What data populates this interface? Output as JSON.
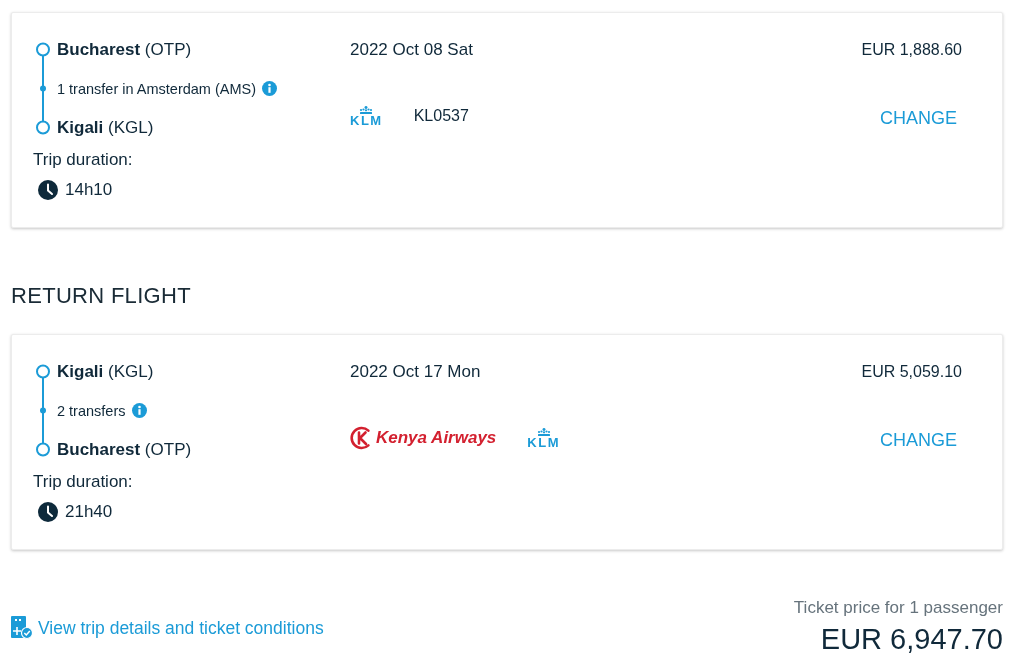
{
  "flights": [
    {
      "origin": "**Bucharest** (OTP)",
      "stops": "1 transfer in Amsterdam (AMS)",
      "destination": "**Kigali** (KGL)",
      "duration_label": "Trip duration:",
      "duration": "14h10",
      "date": "2022 Oct 08 Sat",
      "airlines": [
        {
          "kind": "klm",
          "name": "KLM"
        }
      ],
      "flight_number": "KL0537",
      "price": "EUR 1,888.60",
      "action": "CHANGE"
    },
    {
      "heading": "RETURN FLIGHT",
      "origin": "**Kigali** (KGL)",
      "stops": "2 transfers",
      "destination": "**Bucharest** (OTP)",
      "duration_label": "Trip duration:",
      "duration": "21h40",
      "date": "2022 Oct 17 Mon",
      "airlines": [
        {
          "kind": "kenya",
          "name": "Kenya Airways"
        },
        {
          "kind": "klm",
          "name": "KLM"
        }
      ],
      "price": "EUR 5,059.10",
      "action": "CHANGE"
    }
  ],
  "footer": {
    "link": "View trip details and ticket conditions",
    "price_label": "Ticket price for 1 passenger",
    "total": "EUR 6,947.70"
  }
}
